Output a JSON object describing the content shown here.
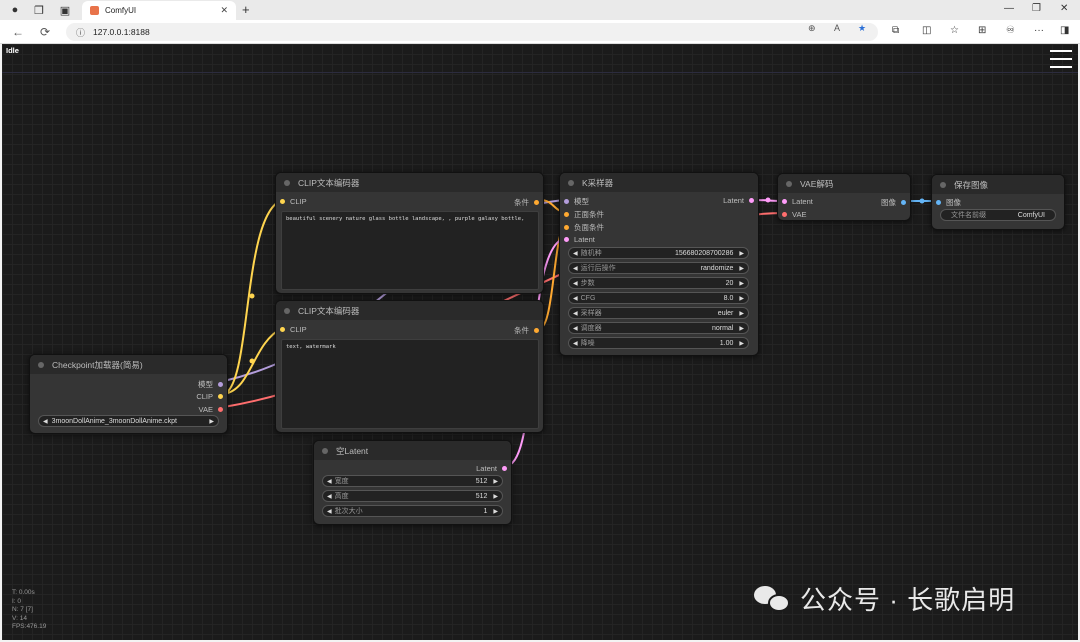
{
  "browser": {
    "tab_title": "ComfyUI",
    "url": "127.0.0.1:8188"
  },
  "app": {
    "status": "Idle"
  },
  "nodes": {
    "clip_pos": {
      "title": "CLIP文本编码器",
      "input": "CLIP",
      "output": "条件",
      "text": "beautiful scenery nature glass bottle landscape, , purple galaxy bottle,"
    },
    "clip_neg": {
      "title": "CLIP文本编码器",
      "input": "CLIP",
      "output": "条件",
      "text": "text, watermark"
    },
    "checkpoint": {
      "title": "Checkpoint加载器(简易)",
      "outputs": [
        "模型",
        "CLIP",
        "VAE"
      ],
      "ckpt_value": "3moonDollAnime_3moonDollAnime.ckpt"
    },
    "empty_latent": {
      "title": "空Latent",
      "output": "Latent",
      "widgets": [
        {
          "label": "宽度",
          "value": "512"
        },
        {
          "label": "高度",
          "value": "512"
        },
        {
          "label": "批次大小",
          "value": "1"
        }
      ]
    },
    "ksampler": {
      "title": "K采样器",
      "inputs": [
        "模型",
        "正面条件",
        "负面条件",
        "Latent"
      ],
      "output": "Latent",
      "widgets": [
        {
          "label": "随机种",
          "value": "156680208700286"
        },
        {
          "label": "运行后操作",
          "value": "randomize"
        },
        {
          "label": "步数",
          "value": "20"
        },
        {
          "label": "CFG",
          "value": "8.0"
        },
        {
          "label": "采样器",
          "value": "euler"
        },
        {
          "label": "调度器",
          "value": "normal"
        },
        {
          "label": "降噪",
          "value": "1.00"
        }
      ]
    },
    "vae_decode": {
      "title": "VAE解码",
      "inputs": [
        "Latent",
        "VAE"
      ],
      "output": "图像"
    },
    "save_image": {
      "title": "保存图像",
      "input": "图像",
      "widget_label": "文件名前缀",
      "widget_value": "ComfyUI"
    }
  },
  "stats": [
    "T: 0.00s",
    "I: 0",
    "N: 7 [7]",
    "V: 14",
    "FPS:476.19"
  ],
  "watermark": "公众号 · 长歌启明",
  "colors": {
    "model": "#b39ddb",
    "clip": "#ffd54f",
    "vae": "#ff6e6e",
    "conditioning": "#ffa931",
    "latent": "#ff9cf9",
    "image": "#64b5f6"
  }
}
